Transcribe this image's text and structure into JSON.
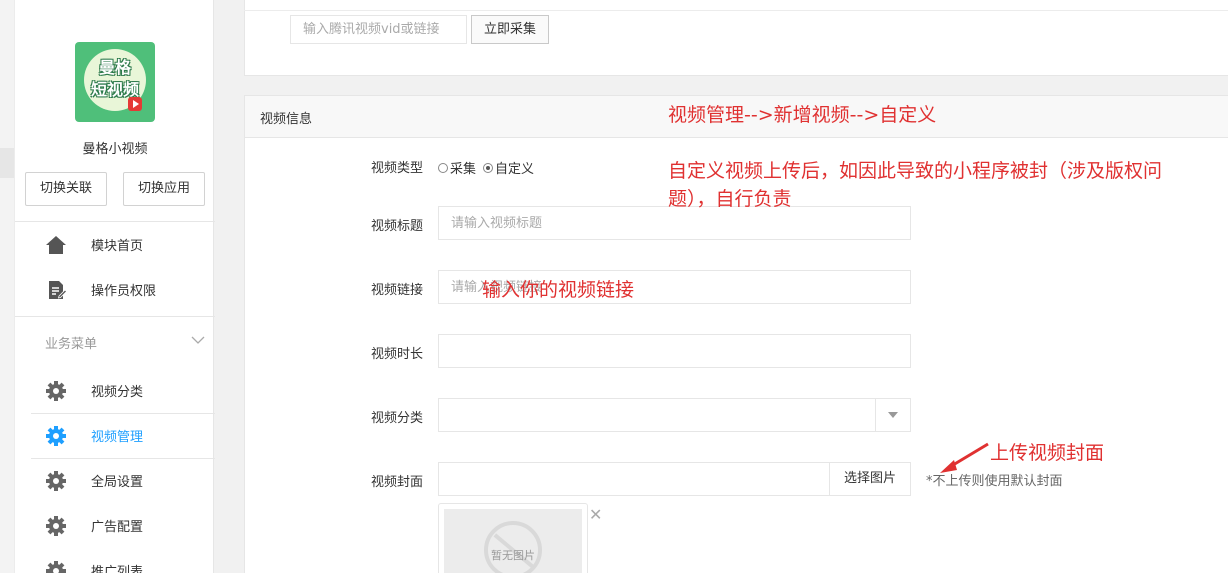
{
  "sidebar": {
    "logo_line1": "曼格",
    "logo_line2": "短视频",
    "app_name": "曼格小视频",
    "switch_link_label": "切换关联",
    "switch_app_label": "切换应用",
    "nav_top": [
      {
        "label": "模块首页",
        "icon": "home-icon"
      },
      {
        "label": "操作员权限",
        "icon": "edit-doc-icon"
      }
    ],
    "group_label": "业务菜单",
    "nav_business": [
      {
        "label": "视频分类",
        "icon": "gear-icon"
      },
      {
        "label": "视频管理",
        "icon": "gear-icon",
        "active": true
      },
      {
        "label": "全局设置",
        "icon": "gear-icon"
      },
      {
        "label": "广告配置",
        "icon": "gear-icon"
      },
      {
        "label": "推广列表",
        "icon": "gear-icon"
      }
    ],
    "active_color": "#1e9fff"
  },
  "collect": {
    "placeholder": "输入腾讯视频vid或链接",
    "button_label": "立即采集"
  },
  "video_info": {
    "panel_title": "视频信息",
    "type_label": "视频类型",
    "type_options": [
      "采集",
      "自定义"
    ],
    "type_selected": "自定义",
    "title_label": "视频标题",
    "title_placeholder": "请输入视频标题",
    "link_label": "视频链接",
    "link_placeholder": "请输入视频链接",
    "duration_label": "视频时长",
    "category_label": "视频分类",
    "cover_label": "视频封面",
    "cover_button": "选择图片",
    "cover_hint": "*不上传则使用默认封面",
    "no_image_text": "暂无图片"
  },
  "annotations": {
    "nav_path": "视频管理-->新增视频-->自定义",
    "warning_line1": "自定义视频上传后，如因此导致的小程序被封（涉及版权问",
    "warning_line2": "题），自行负责",
    "link_note": "输入你的视频链接",
    "cover_note": "上传视频封面",
    "color": "#e03131"
  }
}
